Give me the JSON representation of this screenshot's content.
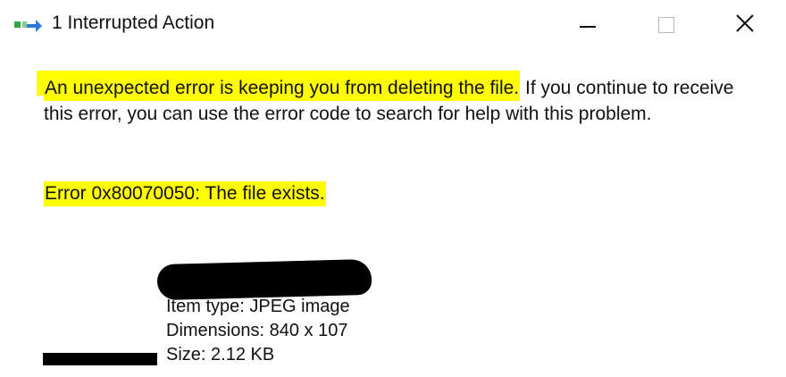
{
  "window": {
    "title": "1 Interrupted Action",
    "icon": "move-file-icon",
    "controls": {
      "minimize": "minimize-icon",
      "maximize": "maximize-icon",
      "close": "close-icon",
      "close_glyph": "✕"
    }
  },
  "message": {
    "highlighted": "An unexpected error is keeping you from deleting the file.",
    "rest": " If you continue to receive this error, you can use the error code to search for help with this problem."
  },
  "error": {
    "code_text": "Error 0x80070050: The file exists."
  },
  "file": {
    "item_type": "Item type: JPEG image",
    "dimensions": "Dimensions: 840 x 107",
    "size": "Size: 2.12 KB"
  },
  "colors": {
    "highlight": "#ffff00",
    "icon_green": "#2fa84a",
    "icon_blue": "#2b7bd6"
  }
}
